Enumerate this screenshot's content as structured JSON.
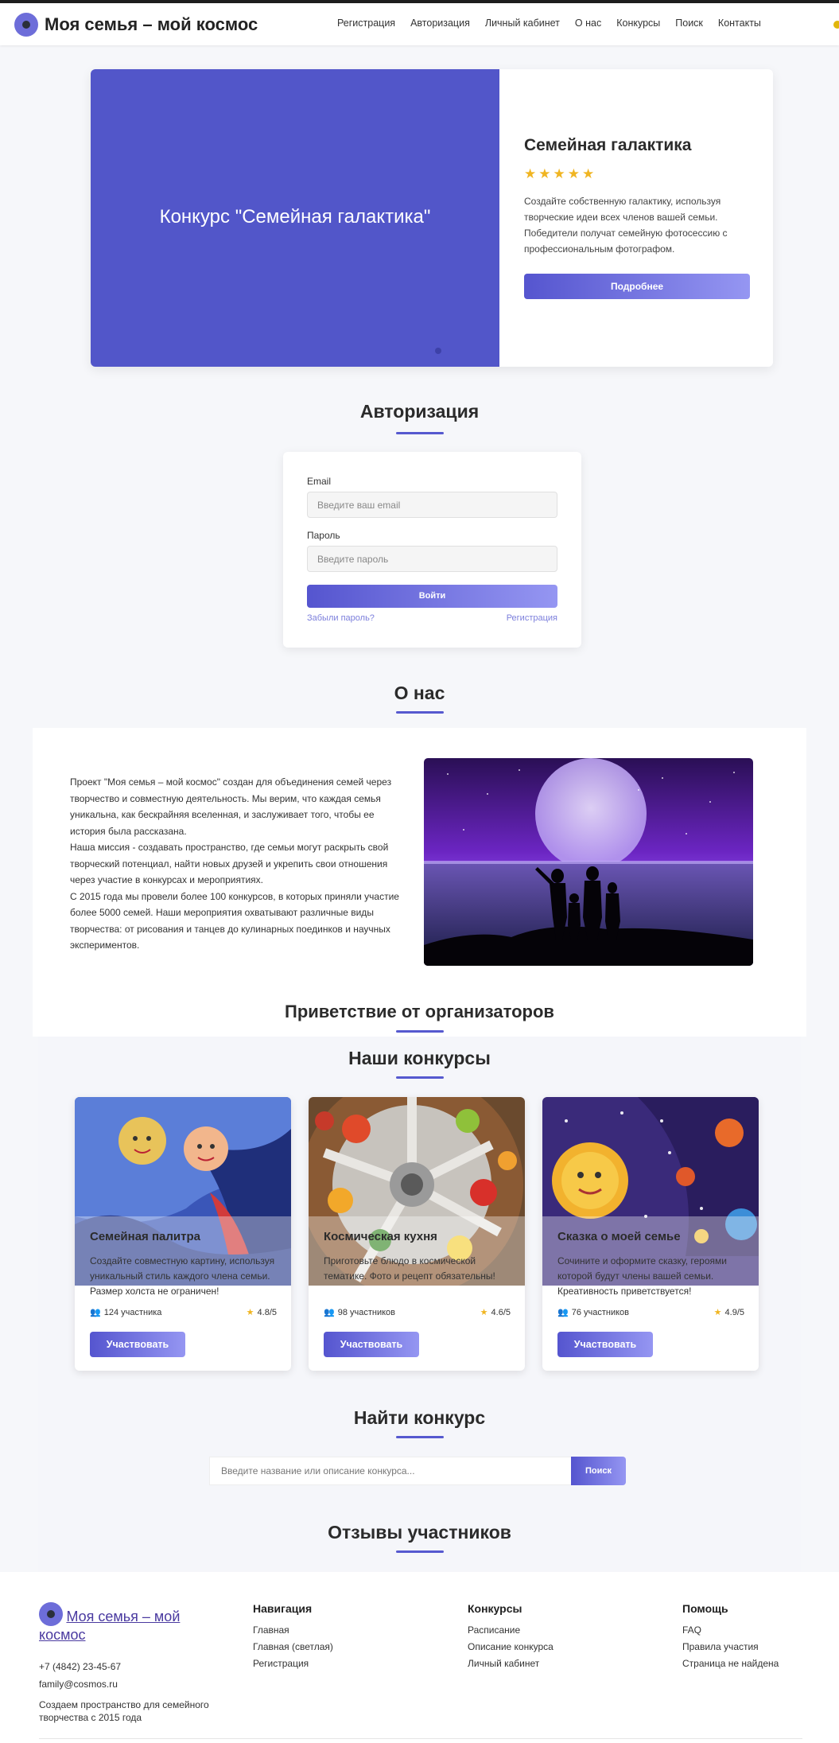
{
  "header": {
    "site_title": "Моя семья – мой космос",
    "nav": [
      "Регистрация",
      "Авторизация",
      "Личный кабинет",
      "О нас",
      "Конкурсы",
      "Поиск",
      "Контакты"
    ]
  },
  "hero": {
    "slide_title": "Конкурс \"Семейная галактика\"",
    "title": "Семейная галактика",
    "rating_stars": "★★★★★",
    "description": "Создайте собственную галактику, используя творческие идеи всех членов вашей семьи. Победители получат семейную фотосессию с профессиональным фотографом.",
    "button": "Подробнее"
  },
  "auth": {
    "title": "Авторизация",
    "email_label": "Email",
    "email_placeholder": "Введите ваш email",
    "password_label": "Пароль",
    "password_placeholder": "Введите пароль",
    "submit": "Войти",
    "forgot": "Забыли пароль?",
    "register": "Регистрация"
  },
  "about": {
    "title": "О нас",
    "paragraphs": [
      "Проект \"Моя семья – мой космос\" создан для объединения семей через творчество и совместную деятельность. Мы верим, что каждая семья уникальна, как бескрайняя вселенная, и заслуживает того, чтобы ее история была рассказана.",
      "Наша миссия - создавать пространство, где семьи могут раскрыть свой творческий потенциал, найти новых друзей и укрепить свои отношения через участие в конкурсах и мероприятиях.",
      "С 2015 года мы провели более 100 конкурсов, в которых приняли участие более 5000 семей. Наши мероприятия охватывают различные виды творчества: от рисования и танцев до кулинарных поединков и научных экспериментов."
    ],
    "greeting_title": "Приветствие от организаторов"
  },
  "contests": {
    "title": "Наши конкурсы",
    "cards": [
      {
        "title": "Семейная палитра",
        "desc": "Создайте совместную картину, используя уникальный стиль каждого члена семьи. Размер холста не ограничен!",
        "participants": "124 участника",
        "rating": "4.8/5",
        "button": "Участвовать"
      },
      {
        "title": "Космическая кухня",
        "desc": "Приготовьте блюдо в космической тематике. Фото и рецепт обязательны!",
        "participants": "98 участников",
        "rating": "4.6/5",
        "button": "Участвовать"
      },
      {
        "title": "Сказка о моей семье",
        "desc": "Сочините и оформите сказку, героями которой будут члены вашей семьи. Креативность приветствуется!",
        "participants": "76 участников",
        "rating": "4.9/5",
        "button": "Участвовать"
      }
    ]
  },
  "search": {
    "title": "Найти конкурс",
    "placeholder": "Введите название или описание конкурса...",
    "button": "Поиск"
  },
  "reviews": {
    "title": "Отзывы участников"
  },
  "footer": {
    "site_title": "Моя семья – мой космос",
    "phone": "+7 (4842) 23-45-67",
    "email": "family@cosmos.ru",
    "tagline": "Создаем пространство для семейного творчества с 2015 года",
    "columns": [
      {
        "title": "Навигация",
        "links": [
          "Главная",
          "Главная (светлая)",
          "Регистрация"
        ]
      },
      {
        "title": "Конкурсы",
        "links": [
          "Расписание",
          "Описание конкурса",
          "Личный кабинет"
        ]
      },
      {
        "title": "Помощь",
        "links": [
          "FAQ",
          "Правила участия",
          "Страница не найдена"
        ]
      }
    ]
  },
  "colors": {
    "accent": "#5659cf",
    "accent_light": "#9596f2",
    "star": "#f0b522"
  }
}
